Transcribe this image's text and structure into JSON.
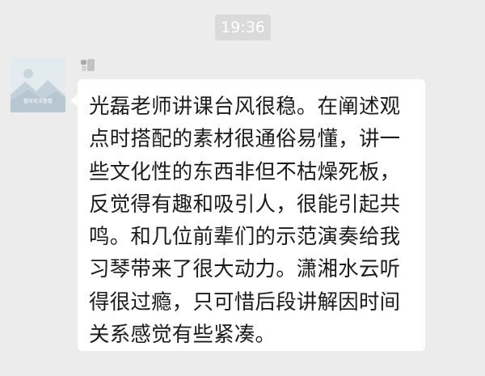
{
  "chat": {
    "timestamp": "19:36",
    "avatar_caption": "暂时无法查看",
    "message_lines": [
      "光磊老师讲课台风很稳。在阐述观",
      "点时搭配的素材很通俗易懂，讲一",
      "些文化性的东西非但不枯燥死板，",
      "反觉得有趣和吸引人，很能引起共",
      "鸣。和几位前辈们的示范演奏给我",
      "习琴带来了很大动力。潇湘水云听",
      "得很过瘾，只可惜后段讲解因时间",
      "关系感觉有些紧凑。"
    ]
  },
  "colors": {
    "background": "#ececec",
    "bubble": "#ffffff",
    "timestamp_badge": "#dadada",
    "text": "#1b1b1b"
  }
}
